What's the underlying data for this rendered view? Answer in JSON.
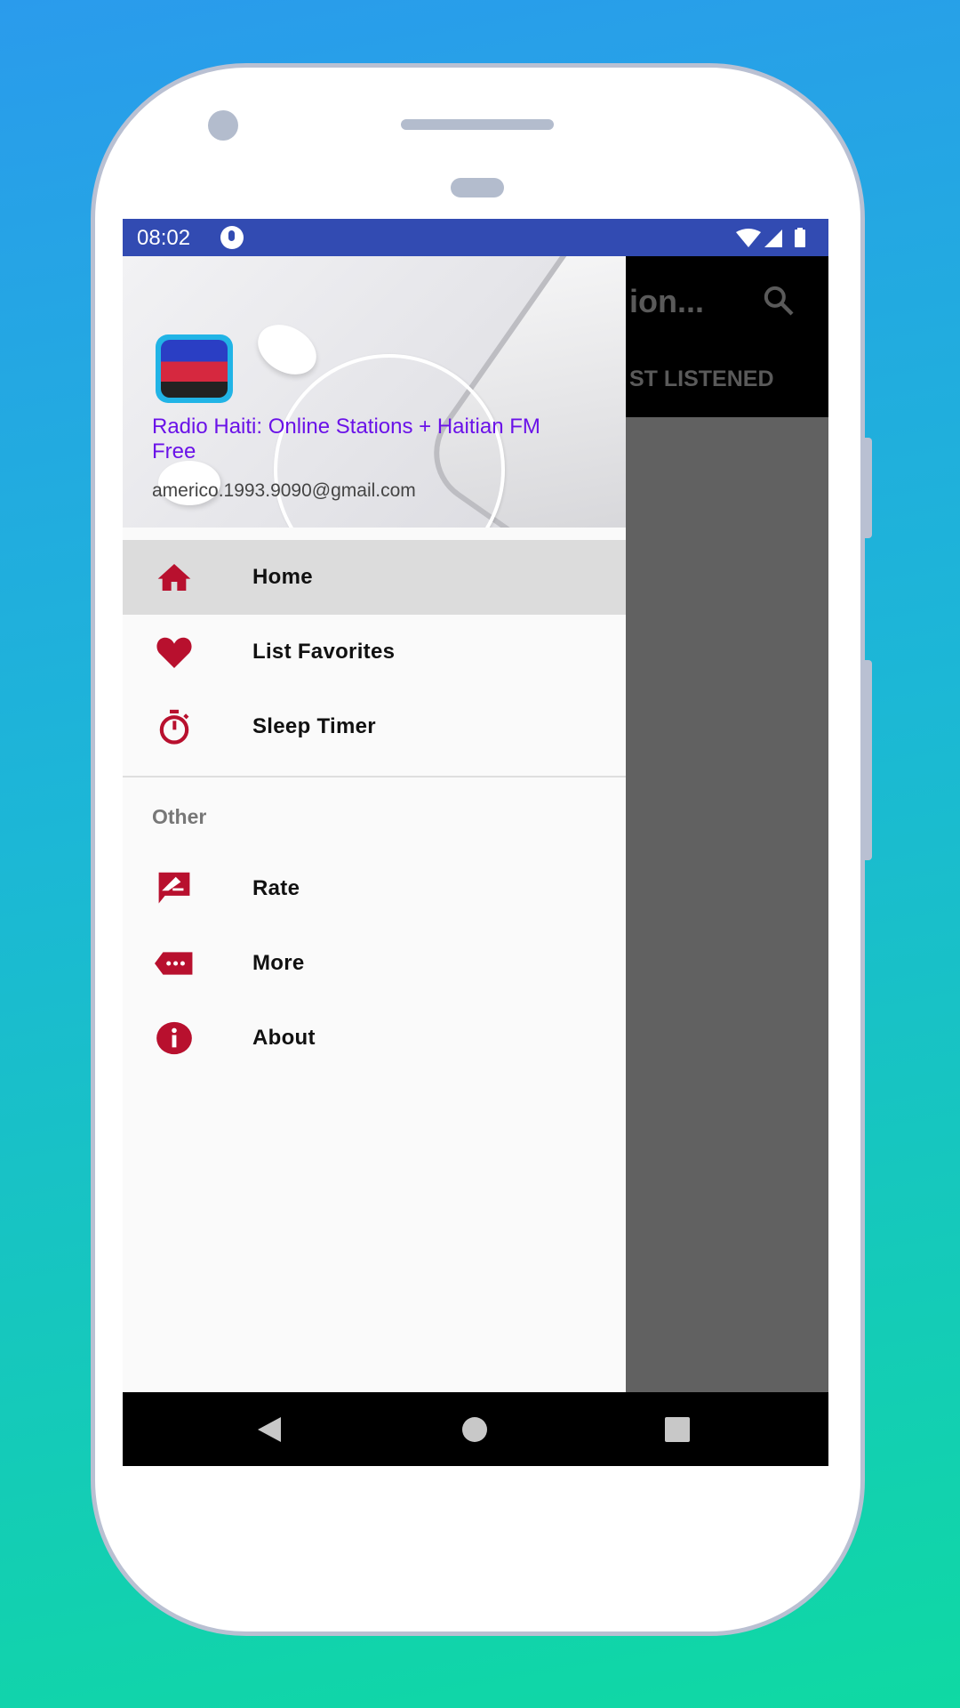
{
  "status_bar": {
    "time": "08:02"
  },
  "toolbar": {
    "title_fragment": "ion...",
    "tab_fragment": "ST LISTENED"
  },
  "drawer": {
    "header": {
      "title": "Radio Haiti: Online Stations + Haitian FM Free",
      "email": "americo.1993.9090@gmail.com"
    },
    "items": [
      {
        "label": "Home",
        "icon": "home-icon",
        "active": true
      },
      {
        "label": "List Favorites",
        "icon": "heart-icon"
      },
      {
        "label": "Sleep Timer",
        "icon": "timer-icon"
      }
    ],
    "section_label": "Other",
    "other_items": [
      {
        "label": "Rate",
        "icon": "rate-icon"
      },
      {
        "label": "More",
        "icon": "more-icon"
      },
      {
        "label": "About",
        "icon": "info-icon"
      }
    ]
  },
  "colors": {
    "accent": "#b8102e",
    "status_bar": "#324bb2",
    "header_title": "#6a12e8"
  }
}
